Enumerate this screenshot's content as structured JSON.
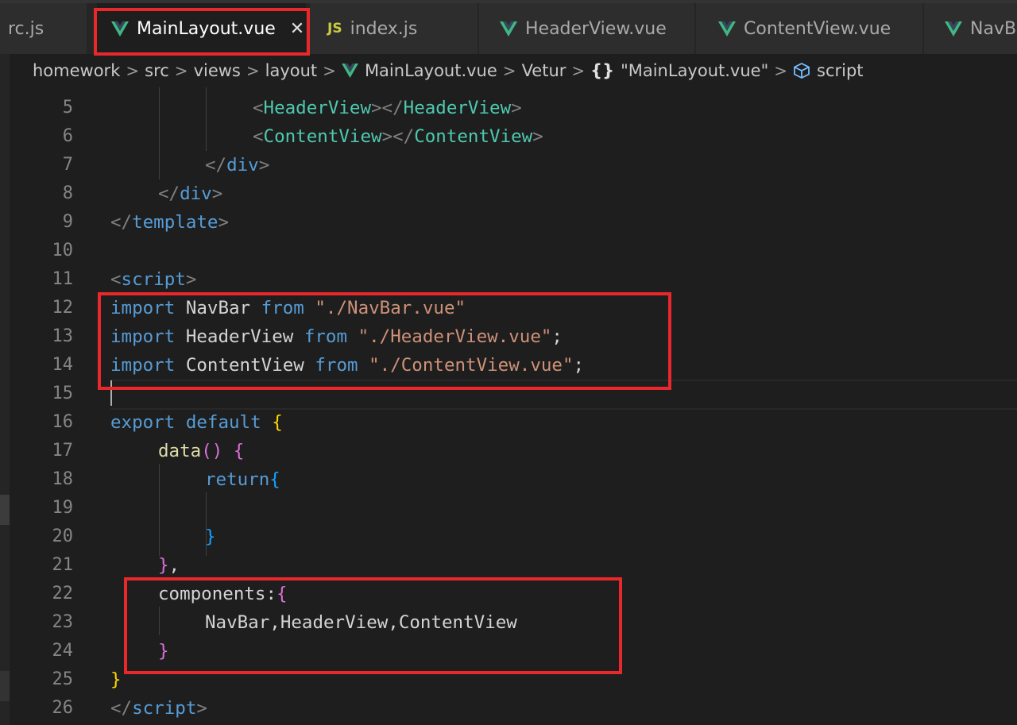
{
  "tabs": [
    {
      "label": "src.js",
      "display": "rc.js",
      "icon": "js-icon",
      "active": false
    },
    {
      "label": "MainLayout.vue",
      "icon": "vue-icon",
      "active": true,
      "close": "✕"
    },
    {
      "label": "index.js",
      "icon": "js-icon",
      "active": false
    },
    {
      "label": "HeaderView.vue",
      "icon": "vue-icon",
      "active": false
    },
    {
      "label": "ContentView.vue",
      "icon": "vue-icon",
      "active": false
    },
    {
      "label": "NavBar.vue",
      "display": "NavBa",
      "icon": "vue-icon",
      "active": false
    }
  ],
  "js_icon_text": "JS",
  "breadcrumb": {
    "items": [
      "homework",
      "src",
      "views",
      "layout",
      "MainLayout.vue",
      "Vetur",
      "\"MainLayout.vue\"",
      "script"
    ],
    "object_icon_text": "{}"
  },
  "editor": {
    "line_numbers": [
      "5",
      "6",
      "7",
      "8",
      "9",
      "10",
      "11",
      "12",
      "13",
      "14",
      "15",
      "16",
      "17",
      "18",
      "19",
      "20",
      "21",
      "22",
      "23",
      "24",
      "25",
      "26"
    ],
    "lines": {
      "l5": [
        "<",
        "HeaderView",
        "></",
        "HeaderView",
        ">"
      ],
      "l6": [
        "<",
        "ContentView",
        "></",
        "ContentView",
        ">"
      ],
      "l7": [
        "</",
        "div",
        ">"
      ],
      "l8": [
        "</",
        "div",
        ">"
      ],
      "l9": [
        "</",
        "template",
        ">"
      ],
      "l11": [
        "<",
        "script",
        ">"
      ],
      "l12": [
        "import",
        " NavBar ",
        "from",
        " \"./NavBar.vue\""
      ],
      "l13": [
        "import",
        " HeaderView ",
        "from",
        " \"./HeaderView.vue\"",
        ";"
      ],
      "l14": [
        "import",
        " ContentView ",
        "from",
        " \"./ContentView.vue\"",
        ";"
      ],
      "l16": [
        "export",
        " ",
        "default",
        " ",
        "{"
      ],
      "l17": [
        "data",
        "()",
        " ",
        "{"
      ],
      "l18": [
        "return",
        "{"
      ],
      "l20": [
        "}"
      ],
      "l21": [
        "}",
        ","
      ],
      "l22": [
        "components",
        ":",
        "{"
      ],
      "l23": [
        "NavBar,HeaderView,ContentView"
      ],
      "l24": [
        "}"
      ],
      "l25": [
        "}"
      ],
      "l26": [
        "</",
        "script",
        ">"
      ]
    }
  },
  "colors": {
    "highlight": "#e8282b",
    "vue_green": "#41b883",
    "js_yellow": "#cbcb41"
  }
}
